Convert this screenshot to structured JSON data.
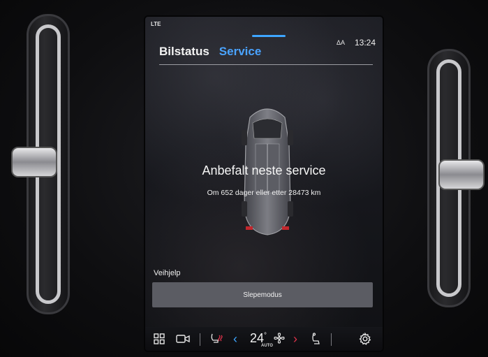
{
  "status_bar": {
    "signal": "LTE",
    "user_badge": "ΔA",
    "time": "13:24"
  },
  "tabs": [
    {
      "label": "Bilstatus",
      "active": false
    },
    {
      "label": "Service",
      "active": true
    }
  ],
  "service": {
    "title": "Anbefalt neste service",
    "subtitle": "Om 652 dager eller etter 28473 km"
  },
  "assistance": {
    "section_label": "Veihjelp",
    "tow_mode_button": "Slepemodus"
  },
  "climate_bar": {
    "temperature": "24",
    "temperature_unit": "°",
    "mode_label": "AUTO"
  },
  "colors": {
    "accent": "#4aa3ff",
    "screen_bg": "#16171c",
    "button_bg": "#5b5c63",
    "arrow_left": "#3ea6ff",
    "arrow_right": "#e0334b"
  },
  "icons": [
    "apps-grid-icon",
    "camera-icon",
    "seat-heat-icon",
    "chevron-left-icon",
    "fan-icon",
    "chevron-right-icon",
    "seat-icon",
    "gear-icon"
  ]
}
